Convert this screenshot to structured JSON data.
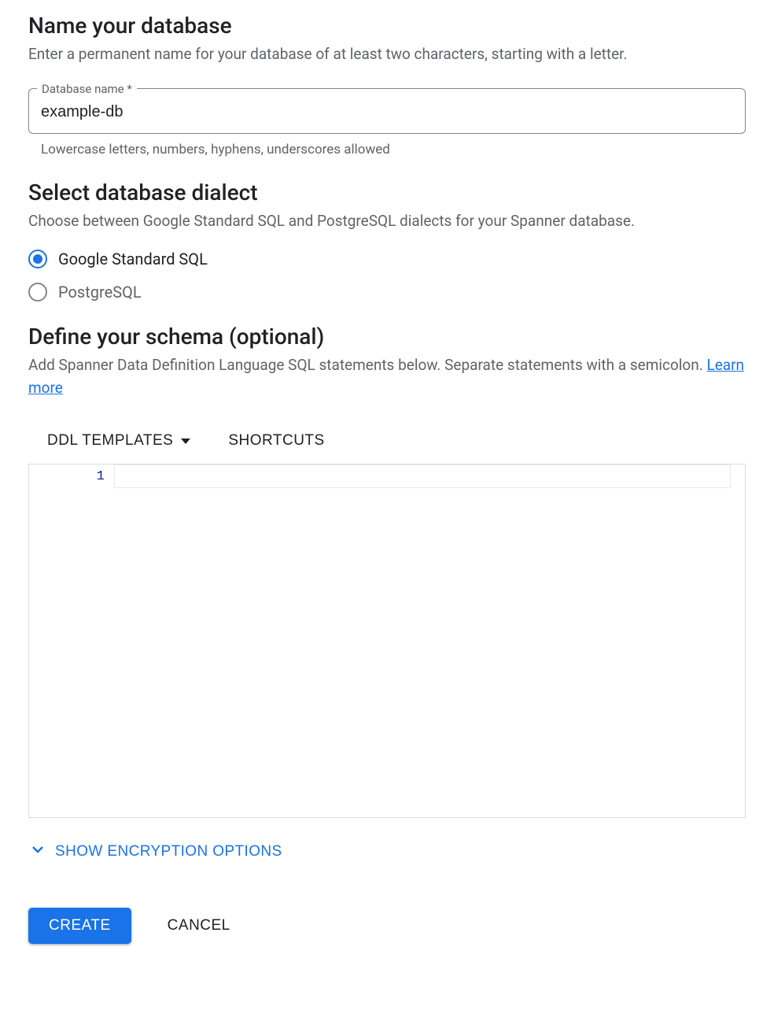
{
  "name_section": {
    "title": "Name your database",
    "description": "Enter a permanent name for your database of at least two characters, starting with a letter.",
    "field_label": "Database name *",
    "field_value": "example-db",
    "helper": "Lowercase letters, numbers, hyphens, underscores allowed"
  },
  "dialect_section": {
    "title": "Select database dialect",
    "description": "Choose between Google Standard SQL and PostgreSQL dialects for your Spanner database.",
    "options": [
      {
        "label": "Google Standard SQL",
        "selected": true
      },
      {
        "label": "PostgreSQL",
        "selected": false
      }
    ]
  },
  "schema_section": {
    "title": "Define your schema (optional)",
    "description_prefix": "Add Spanner Data Definition Language SQL statements below. Separate statements with a semicolon. ",
    "learn_more": "Learn more",
    "toolbar": {
      "ddl_templates": "DDL TEMPLATES",
      "shortcuts": "SHORTCUTS"
    },
    "editor": {
      "line_number": "1",
      "content": ""
    }
  },
  "encryption": {
    "toggle_label": "SHOW ENCRYPTION OPTIONS"
  },
  "buttons": {
    "create": "CREATE",
    "cancel": "CANCEL"
  }
}
